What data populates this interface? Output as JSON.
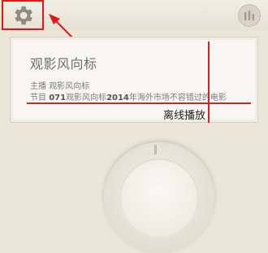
{
  "toolbar": {
    "settings_icon": "gear-icon",
    "equalizer_icon": "equalizer-icon"
  },
  "card": {
    "title": "观影风向标",
    "host_label": "主播",
    "host_name": "观影风向标",
    "program_prefix": "节目",
    "program_number": "071",
    "program_name_a": "观影风向标",
    "program_year": "2014",
    "program_name_b": "年海外市场不容错过的电影",
    "offline_label": "离线播放"
  },
  "colors": {
    "annotation_red": "#e01818",
    "background": "#ece6d8"
  }
}
